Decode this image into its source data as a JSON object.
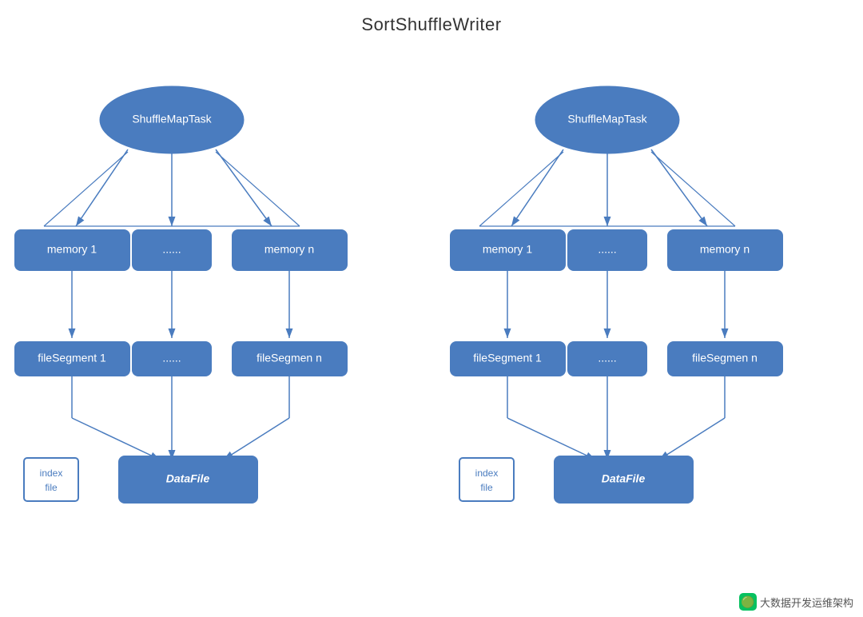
{
  "title": "SortShuffleWriter",
  "diagram": {
    "left": {
      "shuffle_map_task": "ShuffleMapTask",
      "memory1": "memory 1",
      "memory_dots": "......",
      "memory_n": "memory n",
      "file_segment1": "fileSegment 1",
      "file_segment_dots": "......",
      "file_segment_n": "fileSegmen n",
      "index_file": "index\nfile",
      "data_file": "DataFile"
    },
    "right": {
      "shuffle_map_task": "ShuffleMapTask",
      "memory1": "memory 1",
      "memory_dots": "......",
      "memory_n": "memory n",
      "file_segment1": "fileSegment 1",
      "file_segment_dots": "......",
      "file_segment_n": "fileSegmen n",
      "index_file": "index\nfile",
      "data_file": "DataFile"
    }
  },
  "watermark": "大数据开发运维架构"
}
